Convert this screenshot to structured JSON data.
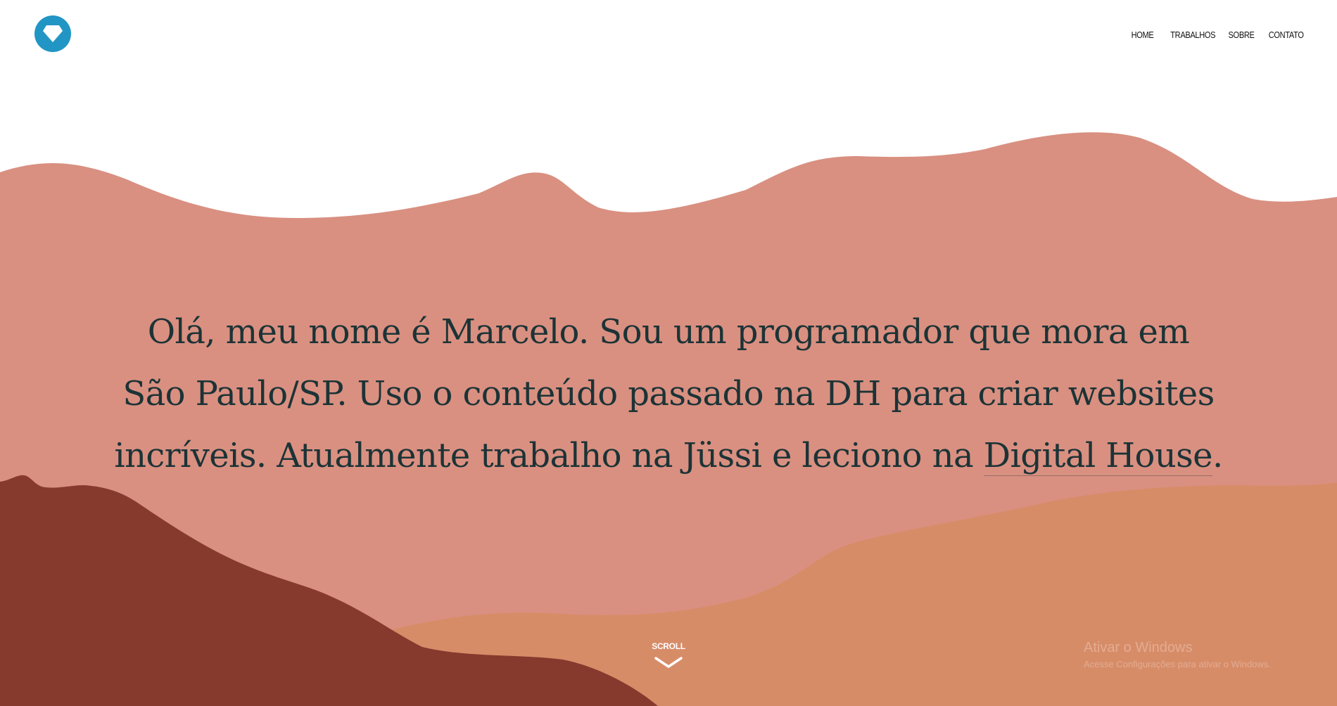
{
  "header": {
    "logo_icon": "diamond-icon",
    "nav": [
      {
        "label": "HOME"
      },
      {
        "label": "TRABALHOS"
      },
      {
        "label": "SOBRE"
      },
      {
        "label": "CONTATO"
      }
    ]
  },
  "hero": {
    "intro_before_link": "Olá, meu nome é Marcelo. Sou um programador que mora em São Paulo/SP. Uso o conteúdo passado na DH para criar websites incríveis. Atualmente trabalho na Jüssi e leciono na ",
    "intro_link": "Digital House",
    "intro_after_link": "."
  },
  "scroll": {
    "label": "SCROLL",
    "icon": "chevron-down-icon"
  },
  "watermark": {
    "title": "Ativar o Windows",
    "subtitle": "Acesse Configurações para ativar o Windows."
  },
  "colors": {
    "logo": "#2196c4",
    "pink_hill": "#d99081",
    "orange_hill": "#d78c68",
    "dark_hill": "#863a2e",
    "text": "#1c3336"
  }
}
